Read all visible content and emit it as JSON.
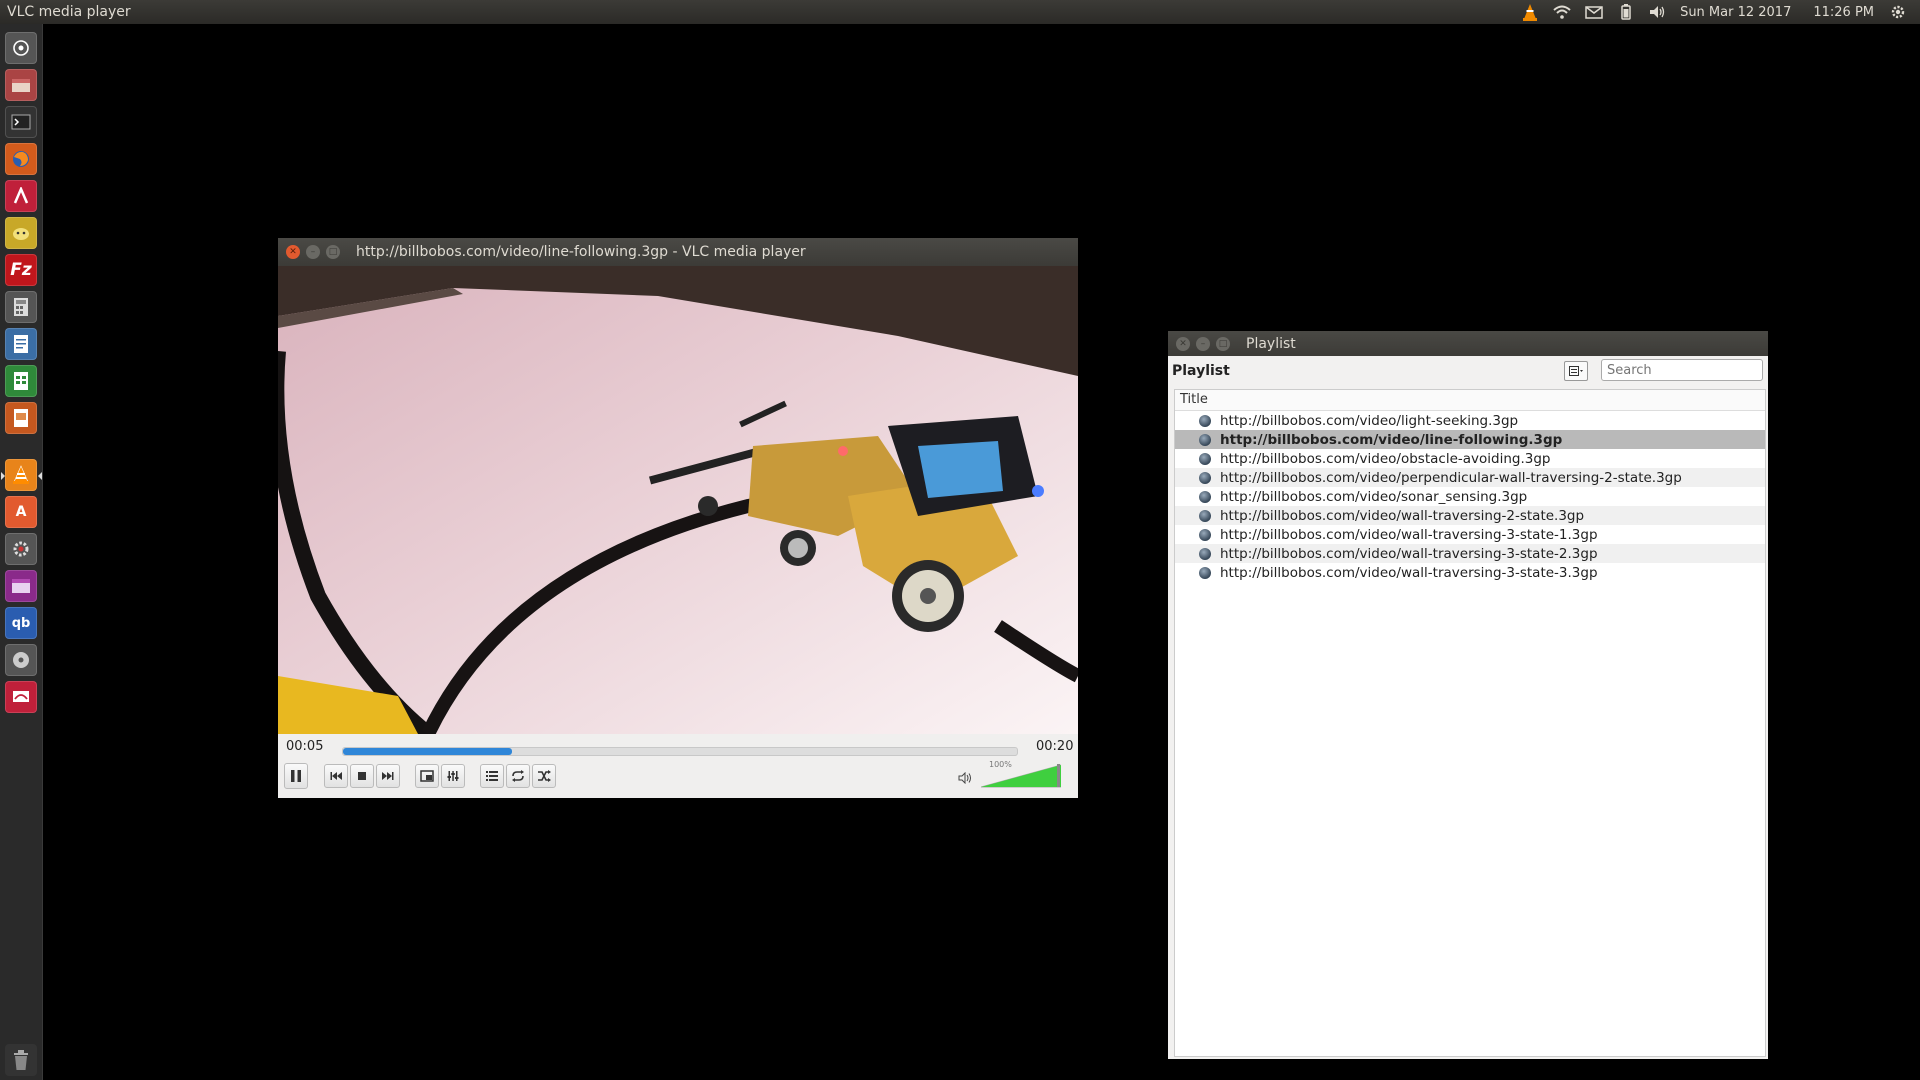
{
  "top_panel": {
    "app_title": "VLC media player",
    "date": "Sun Mar 12 2017",
    "time": "11:26 PM",
    "tray_icons": [
      "vlc-tray-icon",
      "wifi-icon",
      "mail-icon",
      "battery-icon",
      "volume-icon",
      "settings-gear-icon"
    ]
  },
  "launcher": {
    "items": [
      "dash-home-icon",
      "files-icon",
      "terminal-icon",
      "firefox-icon",
      "launcher-app-a-icon",
      "pidgin-icon",
      "filezilla-icon",
      "calculator-icon",
      "writer-icon",
      "calc-spreadsheet-icon",
      "impress-icon",
      "vlc-icon",
      "software-center-icon",
      "system-settings-icon",
      "window-app-icon",
      "qbittorrent-icon",
      "disk-icon",
      "remote-app-icon",
      "trash-icon"
    ]
  },
  "vlc_window": {
    "title": "http://billbobos.com/video/line-following.3gp - VLC media player",
    "elapsed": "00:05",
    "total": "00:20",
    "progress": 0.25,
    "volume_label": "100%",
    "volume": 1.0
  },
  "playlist_window": {
    "title": "Playlist",
    "header_label": "Playlist",
    "search_placeholder": "Search",
    "column_title": "Title",
    "items": [
      {
        "title": "http://billbobos.com/video/light-seeking.3gp"
      },
      {
        "title": "http://billbobos.com/video/line-following.3gp"
      },
      {
        "title": "http://billbobos.com/video/obstacle-avoiding.3gp"
      },
      {
        "title": "http://billbobos.com/video/perpendicular-wall-traversing-2-state.3gp"
      },
      {
        "title": "http://billbobos.com/video/sonar_sensing.3gp"
      },
      {
        "title": "http://billbobos.com/video/wall-traversing-2-state.3gp"
      },
      {
        "title": "http://billbobos.com/video/wall-traversing-3-state-1.3gp"
      },
      {
        "title": "http://billbobos.com/video/wall-traversing-3-state-2.3gp"
      },
      {
        "title": "http://billbobos.com/video/wall-traversing-3-state-3.3gp"
      }
    ],
    "selected_index": 1
  },
  "colors": {
    "accent_blue": "#2f86d8",
    "volume_green": "#3fcf3f",
    "close_orange": "#e25a2f"
  }
}
